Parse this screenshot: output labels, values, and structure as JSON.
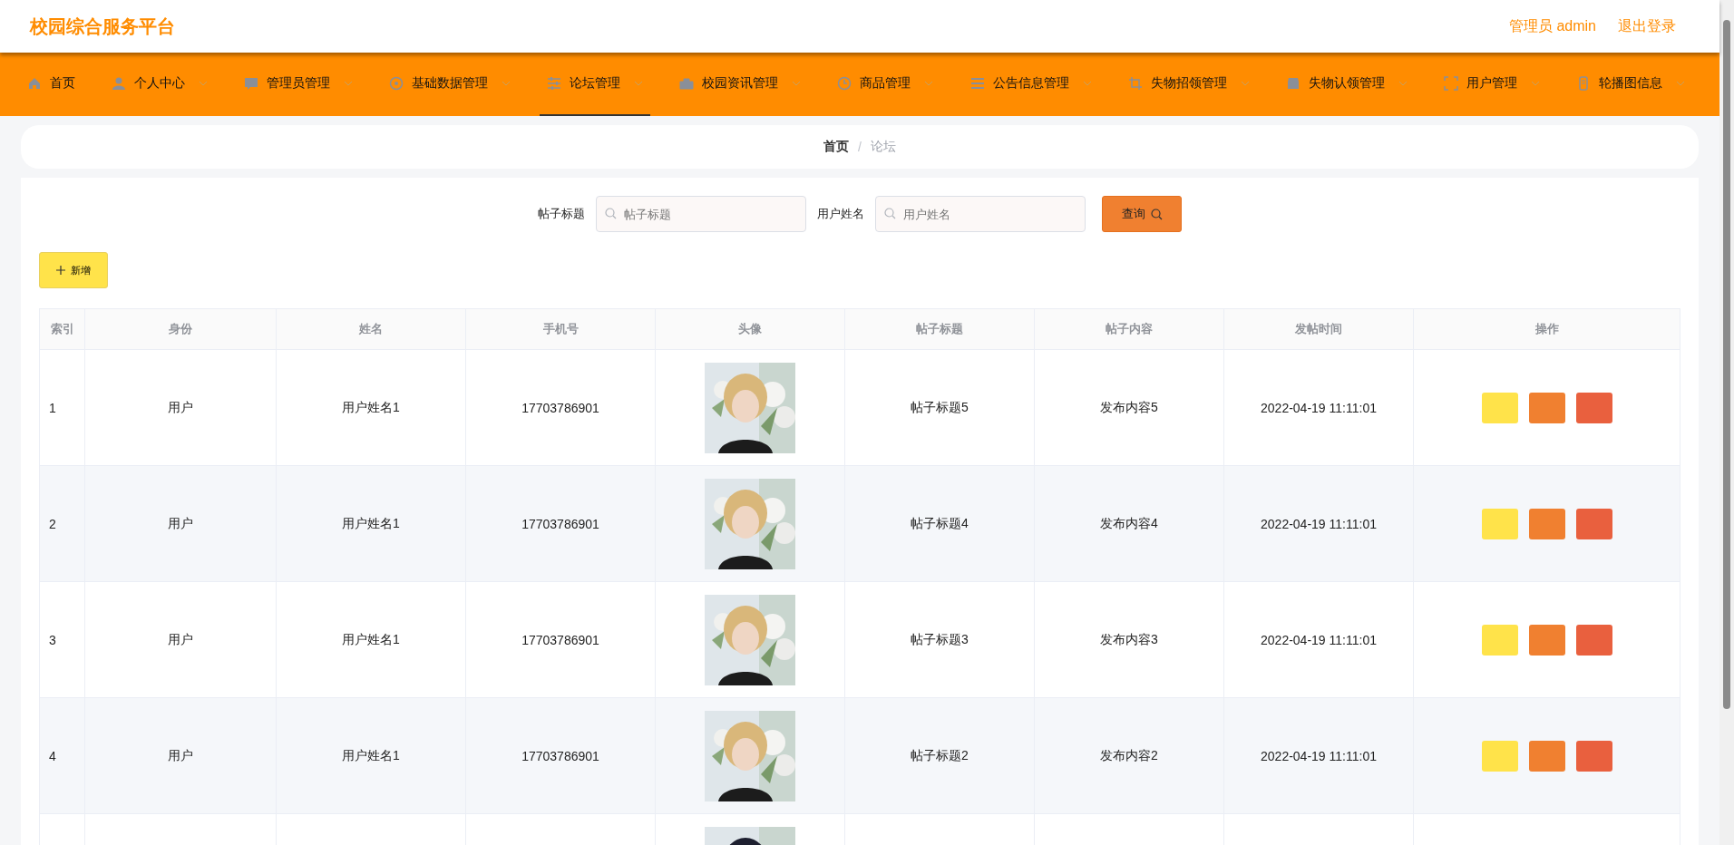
{
  "header": {
    "title": "校园综合服务平台",
    "user": "管理员 admin",
    "logout": "退出登录"
  },
  "nav": [
    {
      "label": "首页",
      "expandable": false,
      "selected": false
    },
    {
      "label": "个人中心",
      "expandable": true,
      "selected": false
    },
    {
      "label": "管理员管理",
      "expandable": true,
      "selected": false
    },
    {
      "label": "基础数据管理",
      "expandable": true,
      "selected": false
    },
    {
      "label": "论坛管理",
      "expandable": true,
      "selected": true
    },
    {
      "label": "校园资讯管理",
      "expandable": true,
      "selected": false
    },
    {
      "label": "商品管理",
      "expandable": true,
      "selected": false
    },
    {
      "label": "公告信息管理",
      "expandable": true,
      "selected": false
    },
    {
      "label": "失物招领管理",
      "expandable": true,
      "selected": false
    },
    {
      "label": "失物认领管理",
      "expandable": true,
      "selected": false
    },
    {
      "label": "用户管理",
      "expandable": true,
      "selected": false
    },
    {
      "label": "轮播图信息",
      "expandable": true,
      "selected": false
    }
  ],
  "breadcrumb": {
    "items": [
      "首页",
      "论坛"
    ],
    "separator": "/"
  },
  "search": {
    "fields": [
      {
        "label": "帖子标题",
        "placeholder": "帖子标题"
      },
      {
        "label": "用户姓名",
        "placeholder": "用户姓名"
      }
    ],
    "button": "查询"
  },
  "add_button": "新增",
  "table": {
    "columns": [
      "索引",
      "身份",
      "姓名",
      "手机号",
      "头像",
      "帖子标题",
      "帖子内容",
      "发帖时间",
      "操作"
    ],
    "rows": [
      {
        "cells": [
          "1",
          "用户",
          "用户姓名1",
          "17703786901",
          "",
          "帖子标题5",
          "发布内容5",
          "2022-04-19 11:11:01"
        ],
        "avatar": {
          "kind": "picture"
        }
      },
      {
        "cells": [
          "2",
          "用户",
          "用户姓名1",
          "17703786901",
          "",
          "帖子标题4",
          "发布内容4",
          "2022-04-19 11:11:01"
        ],
        "avatar": {
          "kind": "picture"
        }
      },
      {
        "cells": [
          "3",
          "用户",
          "用户姓名1",
          "17703786901",
          "",
          "帖子标题3",
          "发布内容3",
          "2022-04-19 11:11:01"
        ],
        "avatar": {
          "kind": "picture"
        }
      },
      {
        "cells": [
          "4",
          "用户",
          "用户姓名1",
          "17703786901",
          "",
          "帖子标题2",
          "发布内容2",
          "2022-04-19 11:11:01"
        ],
        "avatar": {
          "kind": "picture"
        }
      },
      {
        "cells": [],
        "avatar": {
          "kind": "picture"
        }
      }
    ]
  }
}
